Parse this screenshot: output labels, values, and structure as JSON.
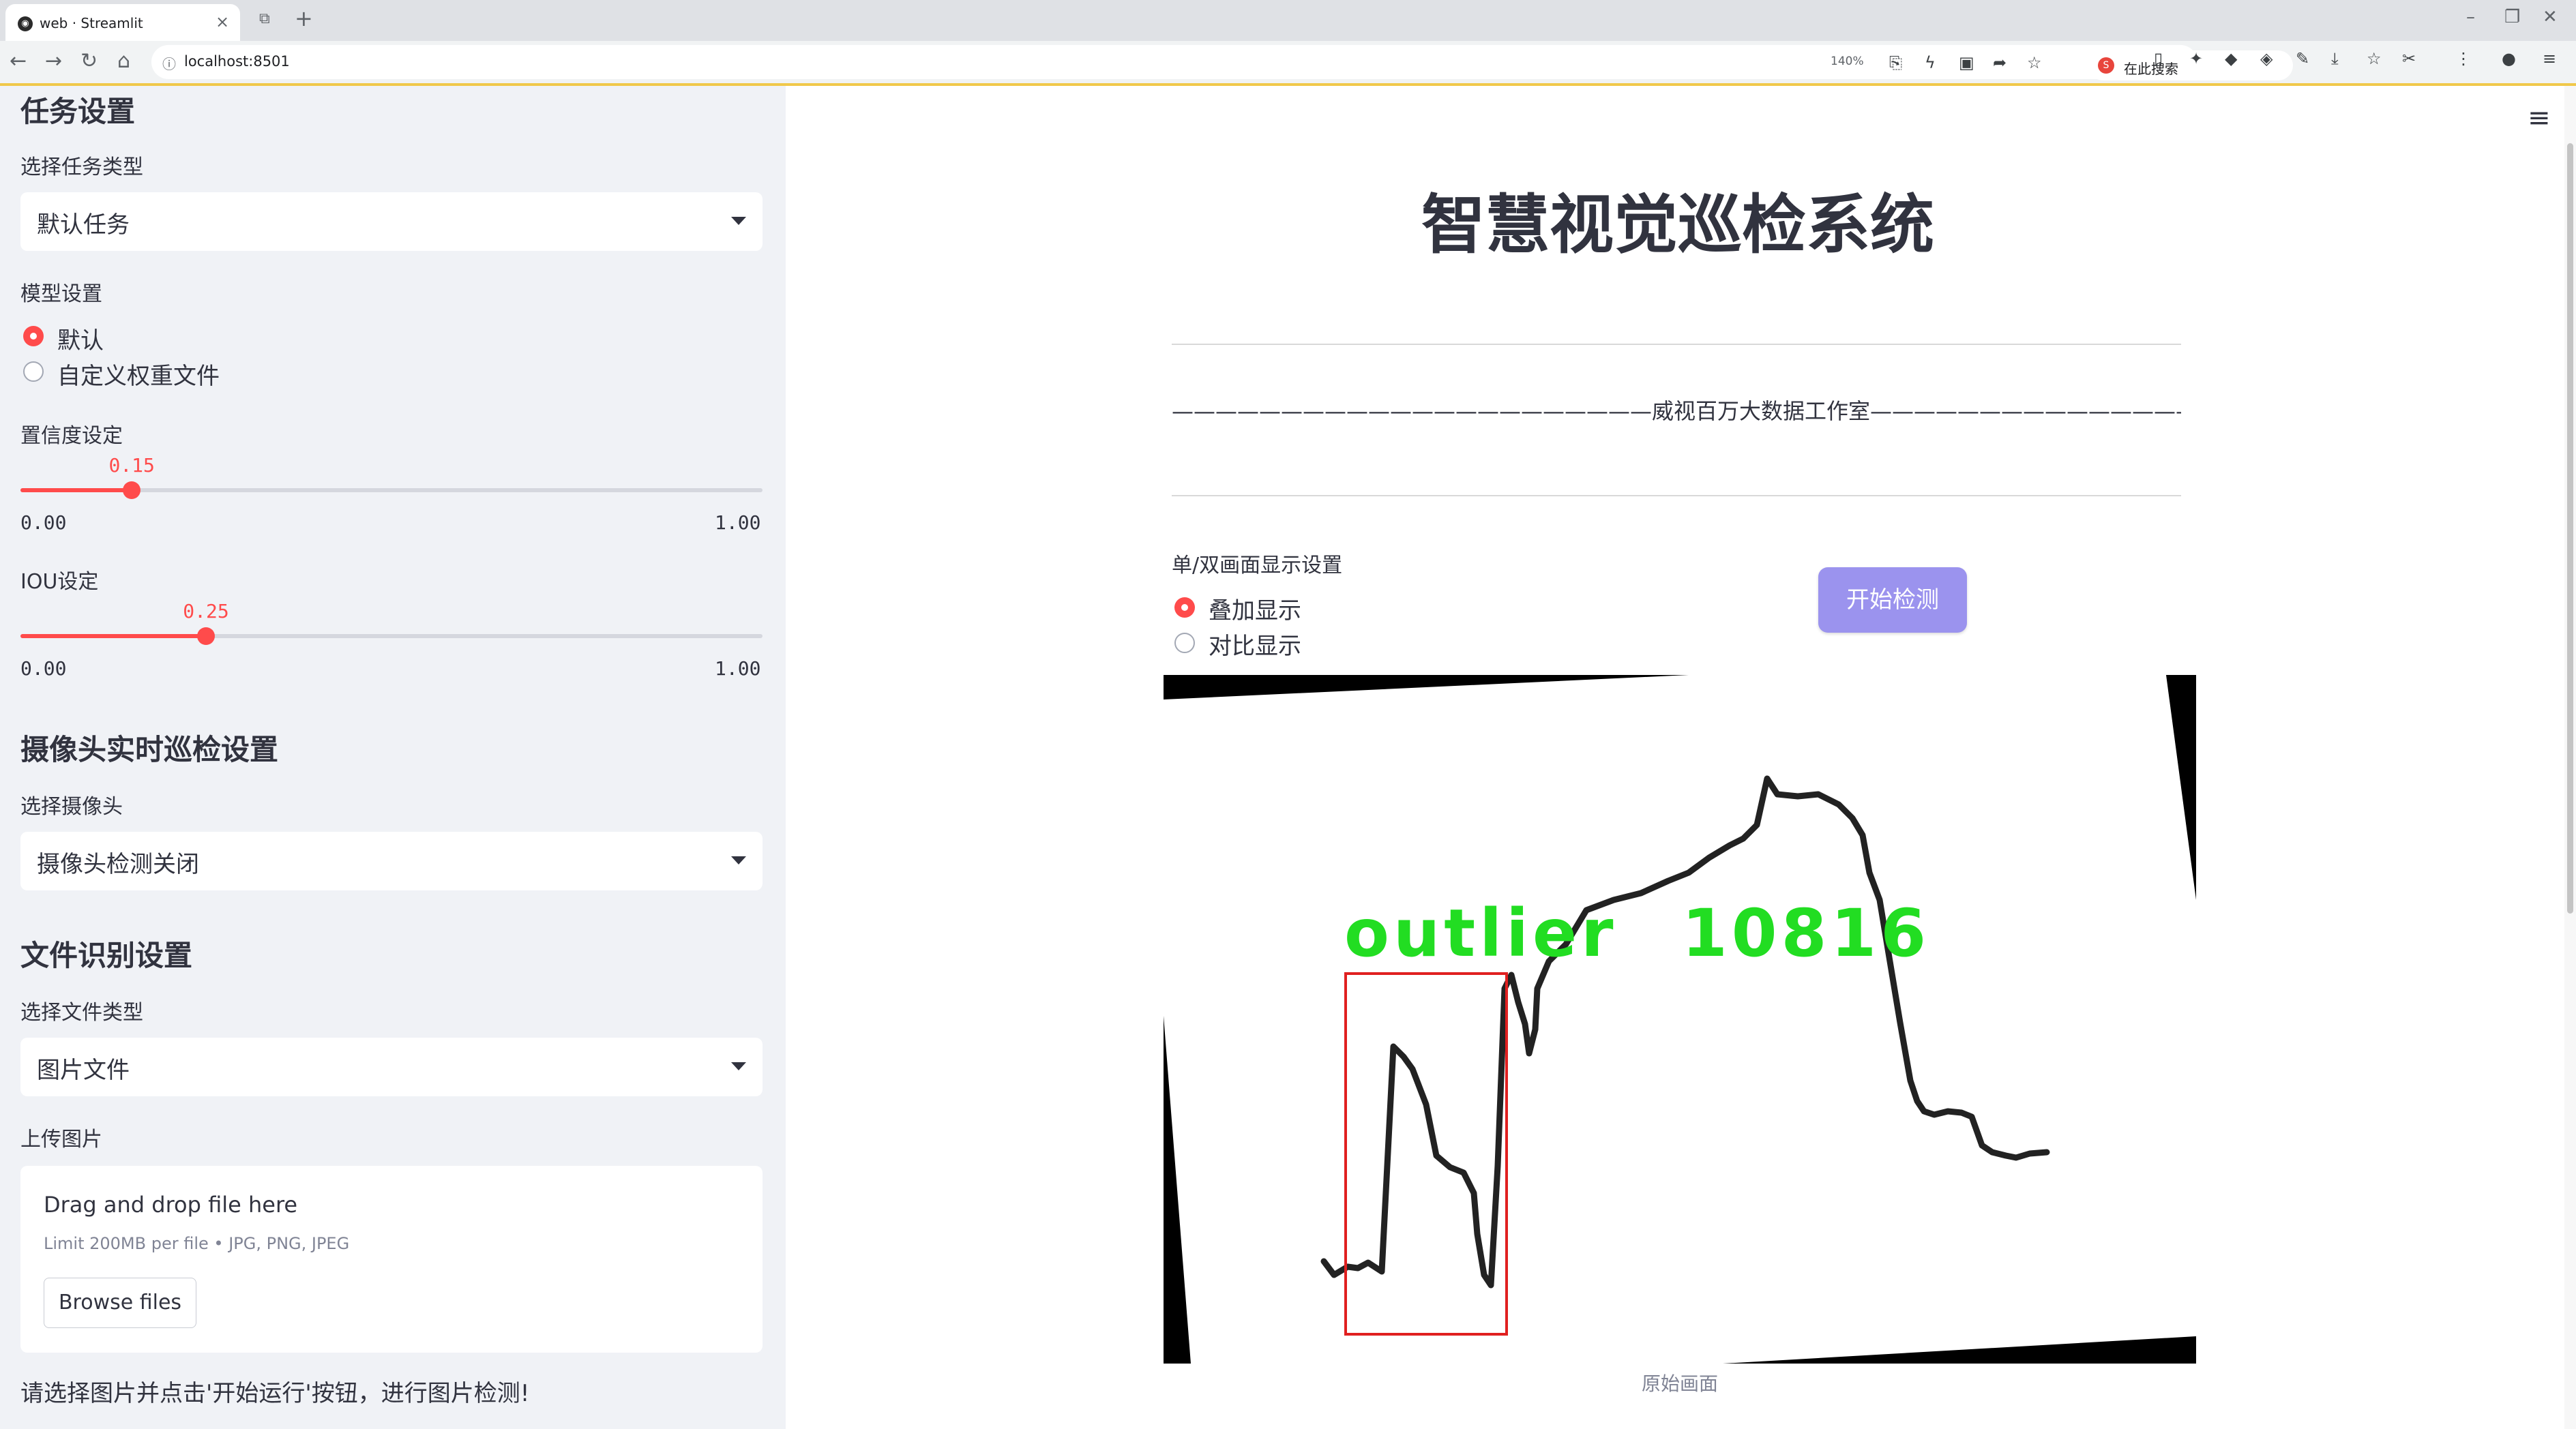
{
  "browser": {
    "tab_title": "web · Streamlit",
    "url": "localhost:8501",
    "zoom": "140%",
    "search_placeholder": "在此搜索"
  },
  "sidebar": {
    "task_heading": "任务设置",
    "task_type_label": "选择任务类型",
    "task_type_value": "默认任务",
    "model_label": "模型设置",
    "model_options": [
      "默认",
      "自定义权重文件"
    ],
    "model_selected": 0,
    "confidence": {
      "label": "置信度设定",
      "value": "0.15",
      "min": "0.00",
      "max": "1.00",
      "fraction": 0.15
    },
    "iou": {
      "label": "IOU设定",
      "value": "0.25",
      "min": "0.00",
      "max": "1.00",
      "fraction": 0.25
    },
    "camera_heading": "摄像头实时巡检设置",
    "camera_label": "选择摄像头",
    "camera_value": "摄像头检测关闭",
    "file_heading": "文件识别设置",
    "file_type_label": "选择文件类型",
    "file_type_value": "图片文件",
    "upload_label": "上传图片",
    "upload_title": "Drag and drop file here",
    "upload_limit": "Limit 200MB per file • JPG, PNG, JPEG",
    "browse_label": "Browse files",
    "footer_note": "请选择图片并点击'开始运行'按钮，进行图片检测!"
  },
  "main": {
    "title": "智慧视觉巡检系统",
    "studio_line": "——————————————————————威视百万大数据工作室————————————————————————",
    "display_label": "单/双画面显示设置",
    "display_options": [
      "叠加显示",
      "对比显示"
    ],
    "display_selected": 0,
    "start_button": "开始检测",
    "detection_label": "outlier",
    "detection_score": "10816",
    "caption": "原始画面"
  },
  "colors": {
    "accent": "#ff4b4b",
    "start_button": "#9b93ee",
    "sidebar_bg": "#f0f2f6",
    "detection_text": "#22dd22",
    "detection_box": "#e02020"
  }
}
